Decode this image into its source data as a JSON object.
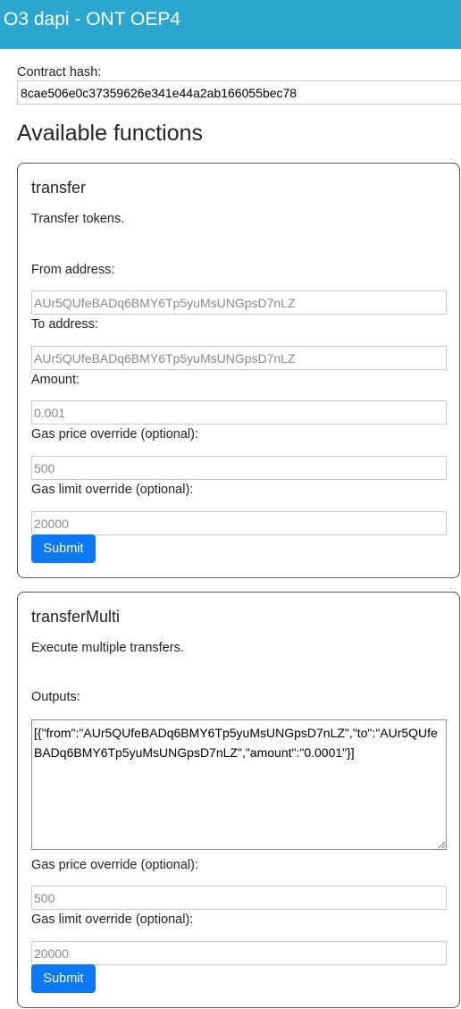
{
  "header": {
    "title": "O3 dapi - ONT OEP4"
  },
  "contract": {
    "label": "Contract hash:",
    "value": "8cae506e0c37359626e341e44a2ab166055bec78"
  },
  "section_title": "Available functions",
  "functions": [
    {
      "name": "transfer",
      "description": "Transfer tokens.",
      "fields": [
        {
          "label": "From address:",
          "placeholder": "AUr5QUfeBADq6BMY6Tp5yuMsUNGpsD7nLZ"
        },
        {
          "label": "To address:",
          "placeholder": "AUr5QUfeBADq6BMY6Tp5yuMsUNGpsD7nLZ"
        },
        {
          "label": "Amount:",
          "placeholder": "0.001"
        },
        {
          "label": "Gas price override (optional):",
          "placeholder": "500"
        },
        {
          "label": "Gas limit override (optional):",
          "placeholder": "20000"
        }
      ],
      "submit_label": "Submit"
    },
    {
      "name": "transferMulti",
      "description": "Execute multiple transfers.",
      "outputs_label": "Outputs:",
      "outputs_value": "[{\"from\":\"AUr5QUfeBADq6BMY6Tp5yuMsUNGpsD7nLZ\",\"to\":\"AUr5QUfeBADq6BMY6Tp5yuMsUNGpsD7nLZ\",\"amount\":\"0.0001\"}]",
      "fields": [
        {
          "label": "Gas price override (optional):",
          "placeholder": "500"
        },
        {
          "label": "Gas limit override (optional):",
          "placeholder": "20000"
        }
      ],
      "submit_label": "Submit"
    }
  ],
  "colors": {
    "header_bg": "#2ba7cf",
    "button_bg": "#0b78f5"
  }
}
